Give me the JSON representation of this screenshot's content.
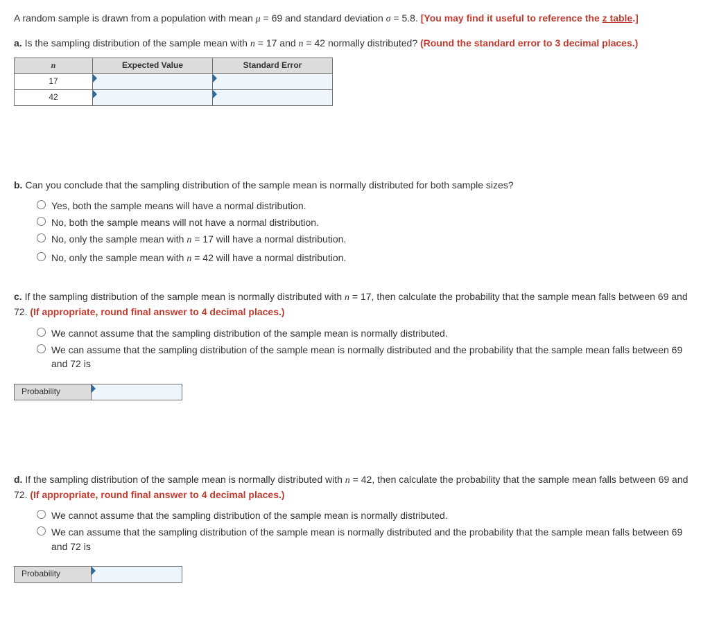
{
  "intro": {
    "text_before": "A random sample is drawn from a population with mean ",
    "mu_sym": "μ",
    "mu_val": " = 69 and standard deviation ",
    "sigma_sym": "σ",
    "sigma_val": " = 5.8. ",
    "bracket_open": "[You may find it useful to reference the ",
    "link": "z table",
    "bracket_close": ".]"
  },
  "a": {
    "label": "a.",
    "text1": " Is the sampling distribution of the sample mean with ",
    "n_sym": "n",
    "eq17": " = 17 and ",
    "eq42": " = 42 normally distributed? ",
    "hint": "(Round the standard error to 3 decimal places.)",
    "table": {
      "h_n": "n",
      "h_ev": "Expected Value",
      "h_se": "Standard Error",
      "r1": "17",
      "r2": "42"
    }
  },
  "b": {
    "label": "b.",
    "text": " Can you conclude that the sampling distribution of the sample mean is normally distributed for both sample sizes?",
    "opts": {
      "o1": "Yes, both the sample means will have a normal distribution.",
      "o2": "No, both the sample means will not have a normal distribution.",
      "o3a": "No, only the sample mean with ",
      "o3b": " = 17 will have a normal distribution.",
      "o4a": "No, only the sample mean with ",
      "o4b": " = 42 will have a normal distribution."
    }
  },
  "c": {
    "label": "c.",
    "text1": " If the sampling distribution of the sample mean is normally distributed with ",
    "eq": " = 17, then calculate the probability that the sample mean falls between 69 and 72. ",
    "hint": "(If appropriate, round final answer to 4 decimal places.)",
    "opts": {
      "o1": "We cannot assume that the sampling distribution of the sample mean is normally distributed.",
      "o2": "We can assume that the sampling distribution of the sample mean is normally distributed and the probability that the sample mean falls between 69 and 72 is"
    },
    "prob_label": "Probability"
  },
  "d": {
    "label": "d.",
    "text1": " If the sampling distribution of the sample mean is normally distributed with ",
    "eq": " = 42, then calculate the probability that the sample mean falls between 69 and 72. ",
    "hint": "(If appropriate, round final answer to 4 decimal places.)",
    "opts": {
      "o1": "We cannot assume that the sampling distribution of the sample mean is normally distributed.",
      "o2": "We can assume that the sampling distribution of the sample mean is normally distributed and the probability that the sample mean falls between 69 and 72 is"
    },
    "prob_label": "Probability"
  }
}
